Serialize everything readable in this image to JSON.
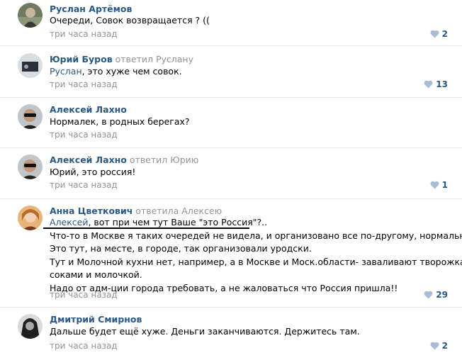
{
  "comments": [
    {
      "author": "Руслан Артёмов",
      "replied": "",
      "mention": "",
      "lines": [
        "Очереди, Совок возвращается ? (("
      ],
      "time": "три часа назад",
      "likes": "2",
      "avatar": "avatar-ruslan"
    },
    {
      "author": "Юрий Буров",
      "replied": "ответил Руслану",
      "mention": "Руслан",
      "lines": [
        ", это хуже чем совок."
      ],
      "time": "три часа назад",
      "likes": "13",
      "avatar": "avatar-yuriy"
    },
    {
      "author": "Алексей Лахно",
      "replied": "",
      "mention": "",
      "lines": [
        "Нормалек, в родных берегах?"
      ],
      "time": "три часа назад",
      "likes": "",
      "avatar": "avatar-aleksey"
    },
    {
      "author": "Алексей Лахно",
      "replied": "ответил Юрию",
      "mention": "",
      "lines": [
        "Юрий, это россия!"
      ],
      "time": "три часа назад",
      "likes": "1",
      "avatar": "avatar-aleksey"
    },
    {
      "author": "Анна Цветкович",
      "replied": "ответила Алексею",
      "mention": "Алексей",
      "lines": [
        ", вот при чем тут Ваше \"это Россия\"?..",
        "Что-то в Москве я таких очередей не видела, и организовано все по-другому, нормально!",
        "Это тут, на месте, в городе, так организовали уродски.",
        "Тут и Молочной кухни нет, например, а в Москве и Моск.области- заваливают творожками",
        "соками и молочкой.",
        "Надо от адм-ции города требовать, а не жаловаться что Россия пришла!!"
      ],
      "time": "три часа назад",
      "likes": "29",
      "avatar": "avatar-anna"
    },
    {
      "author": "Дмитрий Смирнов",
      "replied": "",
      "mention": "",
      "lines": [
        "Дальше будет ещё хуже. Деньги заканчиваются. Держитесь там."
      ],
      "time": "три часа назад",
      "likes": "2",
      "avatar": "avatar-dmitriy"
    }
  ],
  "colors": {
    "link": "#2a5885",
    "muted": "#939393",
    "like_icon": "#a9bed4",
    "divider": "#e7e8ec"
  },
  "icons": {
    "like": "heart-icon"
  }
}
